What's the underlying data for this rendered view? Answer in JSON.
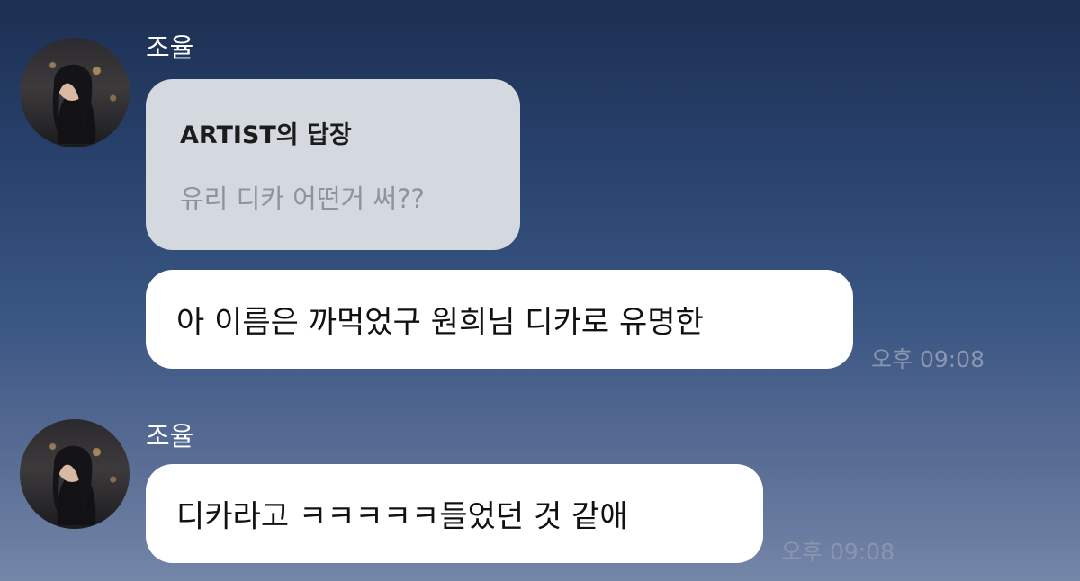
{
  "messages": [
    {
      "sender": "조율",
      "reply": {
        "title": "ARTIST의 답장",
        "quote": "유리 디카 어떤거 써??"
      },
      "text": "아 이름은 까먹었구 원희님 디카로 유명한",
      "time": "오후 09:08"
    },
    {
      "sender": "조율",
      "text": "디카라고 ㅋㅋㅋㅋㅋ들었던 것 같애",
      "time": "오후 09:08"
    }
  ],
  "icons": {
    "moon": "crescent-moon-icon",
    "avatar": "profile-avatar"
  }
}
